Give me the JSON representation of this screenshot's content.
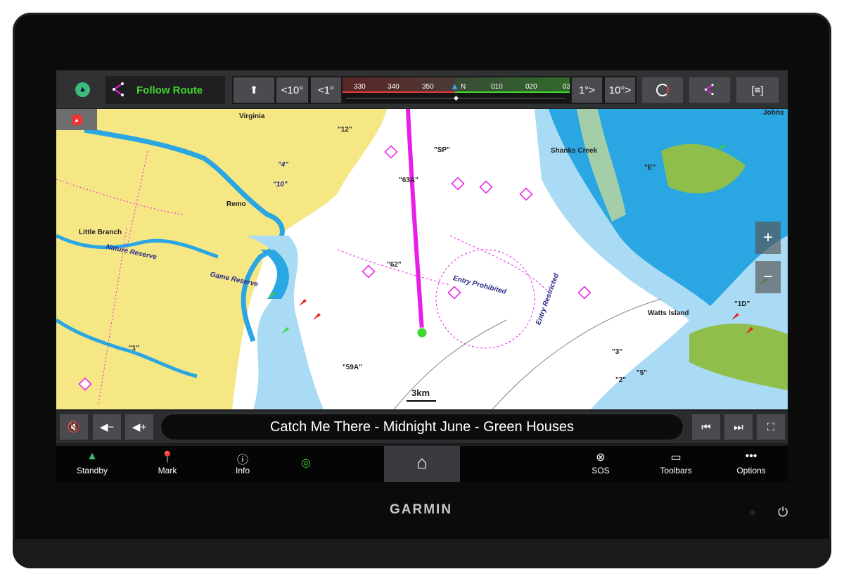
{
  "brand": "GARMIN",
  "topbar": {
    "autopilot_mode": "Follow Route",
    "heading_buttons": [
      "<10°",
      "<1°",
      "1°>",
      "10°>"
    ],
    "compass_labels": [
      "330",
      "340",
      "350",
      "N",
      "010",
      "020",
      "03"
    ]
  },
  "map": {
    "labels": [
      "Virginia",
      "Remo",
      "Little Branch",
      "Nature Reserve",
      "Game Reserve",
      "Shanks Creek",
      "Watts Island",
      "Entry Prohibited",
      "Entry Restricted",
      "\"SP\"",
      "\"63A\"",
      "\"62\"",
      "\"59A\"",
      "\"E\"",
      "\"12\"",
      "\"1D\"",
      "\"4\"",
      "\"10\"",
      "\"3\"",
      "\"5\"",
      "\"2\"",
      "\"1\"",
      "Johns"
    ],
    "scale": "3km",
    "zoom_in": "+",
    "zoom_out": "−",
    "colors": {
      "land": "#f6e785",
      "deep_blue": "#2aa6e2",
      "shallow_blue": "#a9dcf4",
      "route": "#e81ee8"
    }
  },
  "media": {
    "song": "Catch Me There - Midnight June - Green Houses"
  },
  "nav": {
    "items": [
      {
        "label": "Standby",
        "icon": "autopilot-icon"
      },
      {
        "label": "Mark",
        "icon": "pin-icon"
      },
      {
        "label": "Info",
        "icon": "info-icon"
      },
      {
        "label": "",
        "icon": "radar-icon"
      },
      {
        "label": "",
        "icon": "home-icon"
      },
      {
        "label": "SOS",
        "icon": "lifebuoy-icon"
      },
      {
        "label": "Toolbars",
        "icon": "toolbars-icon"
      },
      {
        "label": "Options",
        "icon": "more-icon"
      }
    ]
  }
}
